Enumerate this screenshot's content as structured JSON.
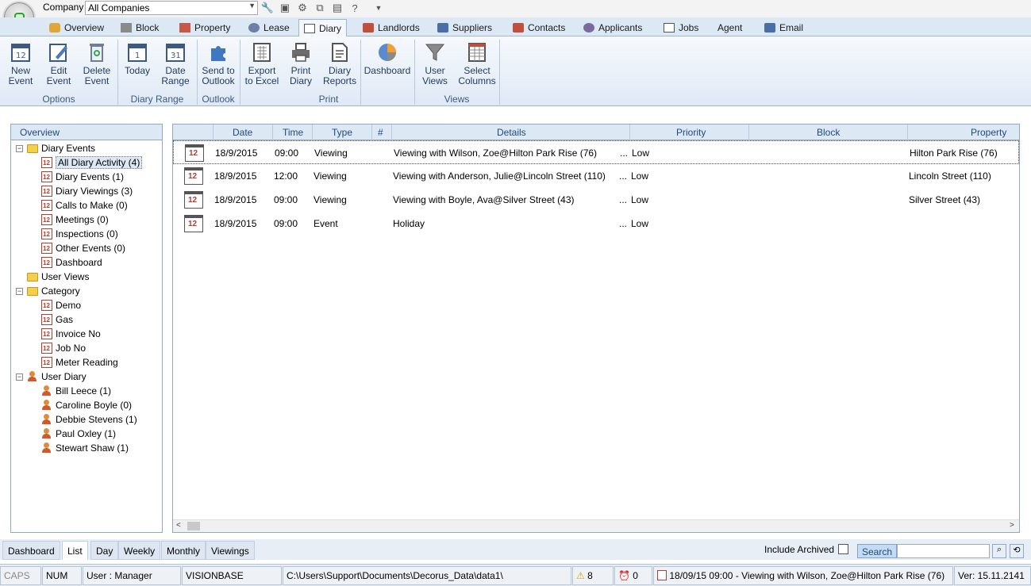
{
  "company": {
    "label": "Company",
    "value": "All Companies"
  },
  "tabs": [
    {
      "label": "Overview",
      "icon": "overview-icon"
    },
    {
      "label": "Block",
      "icon": "block-icon"
    },
    {
      "label": "Property",
      "icon": "property-icon"
    },
    {
      "label": "Lease",
      "icon": "lease-icon"
    },
    {
      "label": "Diary",
      "icon": "diary-icon",
      "active": true
    },
    {
      "label": "Landlords",
      "icon": "landlords-icon"
    },
    {
      "label": "Suppliers",
      "icon": "suppliers-icon"
    },
    {
      "label": "Contacts",
      "icon": "contacts-icon"
    },
    {
      "label": "Applicants",
      "icon": "applicants-icon"
    },
    {
      "label": "Jobs",
      "icon": "jobs-icon"
    },
    {
      "label": "Agent",
      "icon": ""
    },
    {
      "label": "Email",
      "icon": "email-icon"
    }
  ],
  "ribbon": {
    "buttons": [
      {
        "line1": "New",
        "line2": "Event",
        "icon": "calendar-new-icon"
      },
      {
        "line1": "Edit",
        "line2": "Event",
        "icon": "edit-event-icon"
      },
      {
        "line1": "Delete",
        "line2": "Event",
        "icon": "recycle-bin-icon"
      },
      {
        "line1": "Today",
        "line2": "",
        "icon": "calendar-today-icon"
      },
      {
        "line1": "Date",
        "line2": "Range",
        "icon": "calendar-range-icon"
      },
      {
        "line1": "Send to",
        "line2": "Outlook",
        "icon": "puzzle-icon"
      },
      {
        "line1": "Export",
        "line2": "to Excel",
        "icon": "excel-icon"
      },
      {
        "line1": "Print",
        "line2": "Diary",
        "icon": "printer-icon"
      },
      {
        "line1": "Diary",
        "line2": "Reports",
        "icon": "report-icon"
      },
      {
        "line1": "Dashboard",
        "line2": "",
        "icon": "pie-chart-icon"
      },
      {
        "line1": "User",
        "line2": "Views",
        "icon": "filter-icon"
      },
      {
        "line1": "Select",
        "line2": "Columns",
        "icon": "columns-icon"
      }
    ],
    "groups": [
      "Options",
      "Diary Range",
      "Outlook",
      "Print",
      "Views"
    ]
  },
  "tree": {
    "header": "Overview",
    "items": [
      {
        "label": "Diary Events",
        "icon": "folder",
        "level": 0,
        "expander": "−"
      },
      {
        "label": "All Diary Activity (4)",
        "icon": "cal",
        "level": 1,
        "selected": true
      },
      {
        "label": "Diary Events (1)",
        "icon": "cal",
        "level": 1
      },
      {
        "label": "Diary Viewings (3)",
        "icon": "cal",
        "level": 1
      },
      {
        "label": "Calls to Make (0)",
        "icon": "cal",
        "level": 1
      },
      {
        "label": "Meetings (0)",
        "icon": "cal",
        "level": 1
      },
      {
        "label": "Inspections (0)",
        "icon": "cal",
        "level": 1
      },
      {
        "label": "Other Events (0)",
        "icon": "cal",
        "level": 1
      },
      {
        "label": "Dashboard",
        "icon": "cal",
        "level": 1
      },
      {
        "label": "User Views",
        "icon": "folder",
        "level": 0
      },
      {
        "label": "Category",
        "icon": "folder",
        "level": 0,
        "expander": "−"
      },
      {
        "label": "Demo",
        "icon": "cal",
        "level": 1
      },
      {
        "label": "Gas",
        "icon": "cal",
        "level": 1
      },
      {
        "label": "Invoice No",
        "icon": "cal",
        "level": 1
      },
      {
        "label": "Job No",
        "icon": "cal",
        "level": 1
      },
      {
        "label": "Meter Reading",
        "icon": "cal",
        "level": 1
      },
      {
        "label": "User Diary",
        "icon": "person",
        "level": 0,
        "expander": "−"
      },
      {
        "label": "Bill Leece (1)",
        "icon": "person",
        "level": 1
      },
      {
        "label": "Caroline Boyle (0)",
        "icon": "person",
        "level": 1
      },
      {
        "label": "Debbie Stevens (1)",
        "icon": "person",
        "level": 1
      },
      {
        "label": "Paul Oxley (1)",
        "icon": "person",
        "level": 1
      },
      {
        "label": "Stewart Shaw (1)",
        "icon": "person",
        "level": 1
      }
    ]
  },
  "grid": {
    "columns": [
      "Date",
      "Time",
      "Type",
      "#",
      "Details",
      "Priority",
      "Block",
      "Property"
    ],
    "rows": [
      {
        "date": "18/9/2015",
        "time": "09:00",
        "type": "Viewing",
        "details": "Viewing with Wilson, Zoe@Hilton Park Rise (76)",
        "dots": "...",
        "priority": "Low",
        "block": "",
        "property": "Hilton Park Rise (76)"
      },
      {
        "date": "18/9/2015",
        "time": "12:00",
        "type": "Viewing",
        "details": "Viewing with Anderson, Julie@Lincoln Street (110)",
        "dots": "...",
        "priority": "Low",
        "block": "",
        "property": "Lincoln Street (110)"
      },
      {
        "date": "18/9/2015",
        "time": "09:00",
        "type": "Viewing",
        "details": "Viewing with Boyle, Ava@Silver Street (43)",
        "dots": "...",
        "priority": "Low",
        "block": "",
        "property": "Silver Street (43)"
      },
      {
        "date": "18/9/2015",
        "time": "09:00",
        "type": "Event",
        "details": "Holiday",
        "dots": "...",
        "priority": "Low",
        "block": "",
        "property": ""
      }
    ]
  },
  "bottom_tabs": [
    "Dashboard",
    "List",
    "Day",
    "Weekly",
    "Monthly",
    "Viewings"
  ],
  "include_archived": "Include Archived",
  "search_label": "Search",
  "status": {
    "caps": "CAPS",
    "num": "NUM",
    "user": "User : Manager",
    "db": "VISIONBASE",
    "path": "C:\\Users\\Support\\Documents\\Decorus_Data\\data1\\",
    "warnings": "8",
    "alarms": "0",
    "next_event": "18/09/15 09:00 - Viewing with Wilson, Zoe@Hilton Park Rise (76)",
    "version": "Ver: 15.11.2141"
  }
}
